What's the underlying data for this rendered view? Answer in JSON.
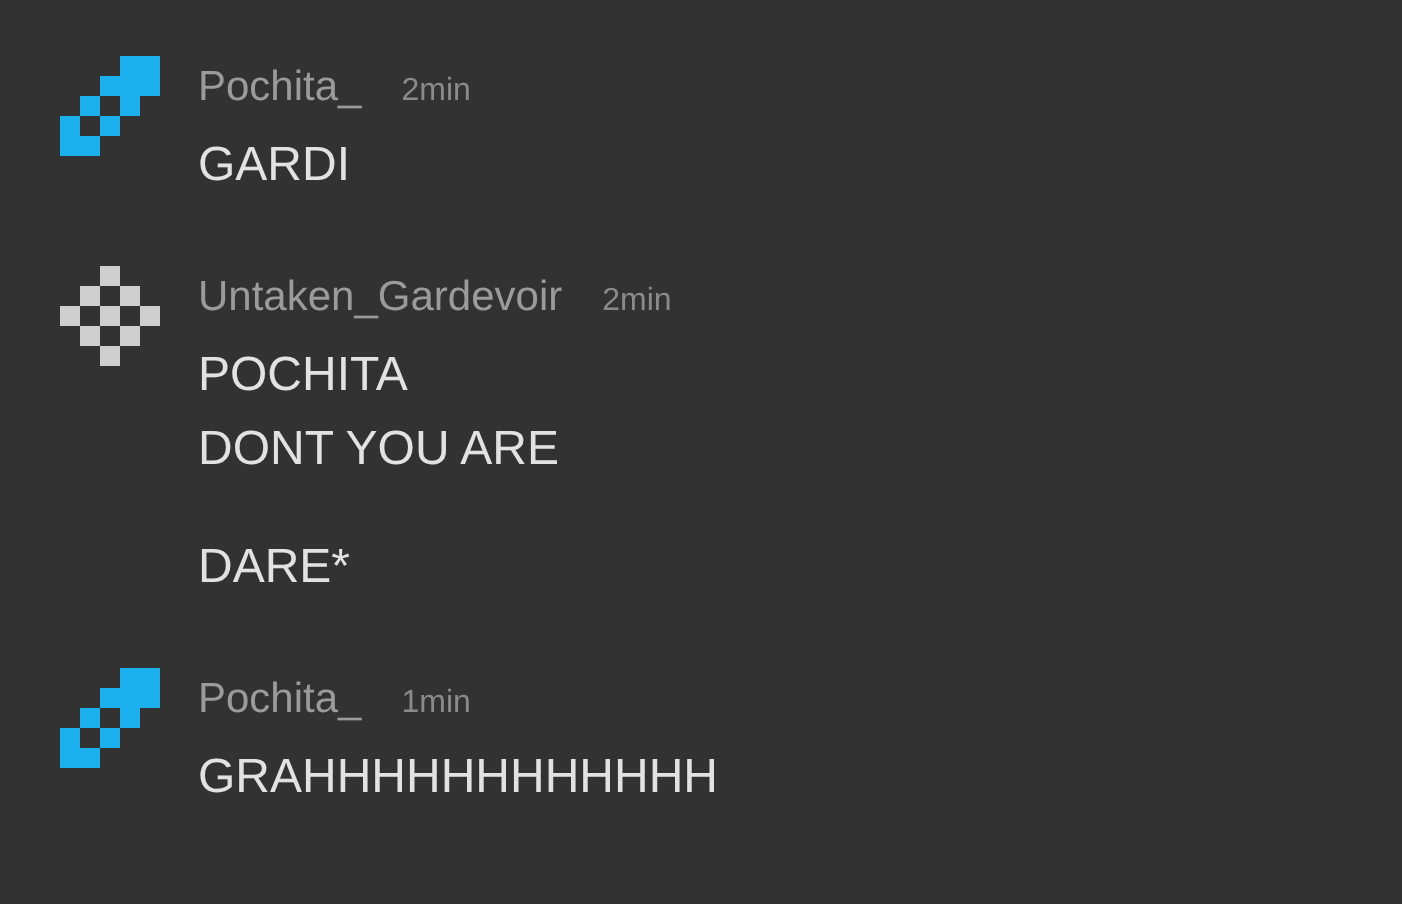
{
  "messages": [
    {
      "kind": "diagonal",
      "author": "Pochita_",
      "time": "2min",
      "paragraphs": [
        [
          "GARDI"
        ]
      ]
    },
    {
      "kind": "diamond",
      "author": "Untaken_Gardevoir",
      "time": "2min",
      "paragraphs": [
        [
          "POCHITA",
          "DONT YOU ARE"
        ],
        [
          "DARE*"
        ]
      ]
    },
    {
      "kind": "diagonal",
      "author": "Pochita_",
      "time": "1min",
      "paragraphs": [
        [
          "GRAHHHHHHHHHHHH"
        ]
      ]
    }
  ]
}
